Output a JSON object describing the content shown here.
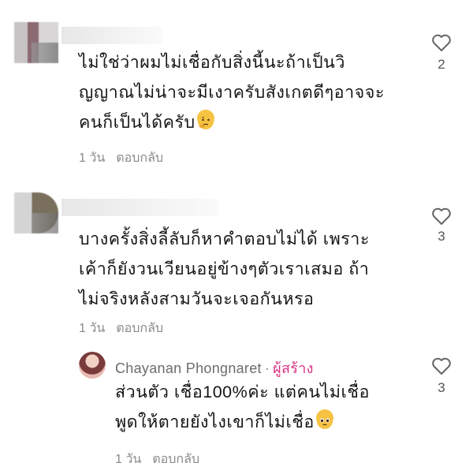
{
  "comments": [
    {
      "lines": [
        "ไม่ใช่ว่าผมไม่เชื่อกับสิ่งนี้นะถ้าเป็นวิ",
        "ญญาณไม่น่าจะมีเงาครับสังเกตดีๆอาจจะ",
        "คนก็เป็นได้ครับ"
      ],
      "emoji": "thinking-face-emoji",
      "time": "1 วัน",
      "reply": "ตอบกลับ",
      "likes": "2"
    },
    {
      "lines": [
        "บางครั้งสิ่งลี้ลับก็หาคำตอบไม่ได้ เพราะ",
        "เค้าก็ยังวนเวียนอยู่ข้างๆตัวเราเสมอ ถ้า",
        "ไม่จริงหลังสามวันจะเจอกันหรอ"
      ],
      "time": "1 วัน",
      "reply": "ตอบกลับ",
      "likes": "3"
    }
  ],
  "creator_reply": {
    "name": "Chayanan Phongnaret",
    "separator": "·",
    "badge": "ผู้สร้าง",
    "lines": [
      "ส่วนตัว เชื่อ100%ค่ะ แต่คนไม่เชื่อ",
      "พูดให้ตายยังไงเขาก็ไม่เชื่อ"
    ],
    "emoji": "pleading-face-emoji",
    "time": "1 วัน",
    "reply": "ตอบกลับ",
    "likes": "3"
  }
}
